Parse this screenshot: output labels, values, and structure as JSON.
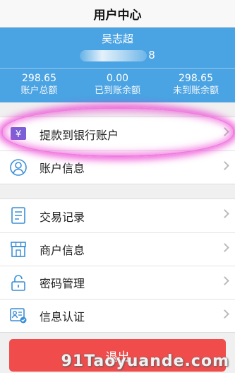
{
  "title": "用户中心",
  "account": {
    "name": "吴志超",
    "number_visible_tail": "8"
  },
  "stats": [
    {
      "value": "298.65",
      "label": "账户总额"
    },
    {
      "value": "0.00",
      "label": "已到账余额"
    },
    {
      "value": "298.65",
      "label": "未到账余额"
    }
  ],
  "menu_group1": [
    {
      "label": "提款到银行账户",
      "icon": "yen-card-icon"
    },
    {
      "label": "账户信息",
      "icon": "user-icon"
    }
  ],
  "menu_group2": [
    {
      "label": "交易记录",
      "icon": "document-icon"
    },
    {
      "label": "商户信息",
      "icon": "store-icon"
    },
    {
      "label": "密码管理",
      "icon": "lock-icon"
    },
    {
      "label": "信息认证",
      "icon": "id-card-icon"
    }
  ],
  "logout_label": "退出",
  "watermark": "91Taoyuande.com",
  "colors": {
    "header": "#4aa3e2",
    "logout": "#f04c4c",
    "highlight": "#eb3cd2"
  }
}
